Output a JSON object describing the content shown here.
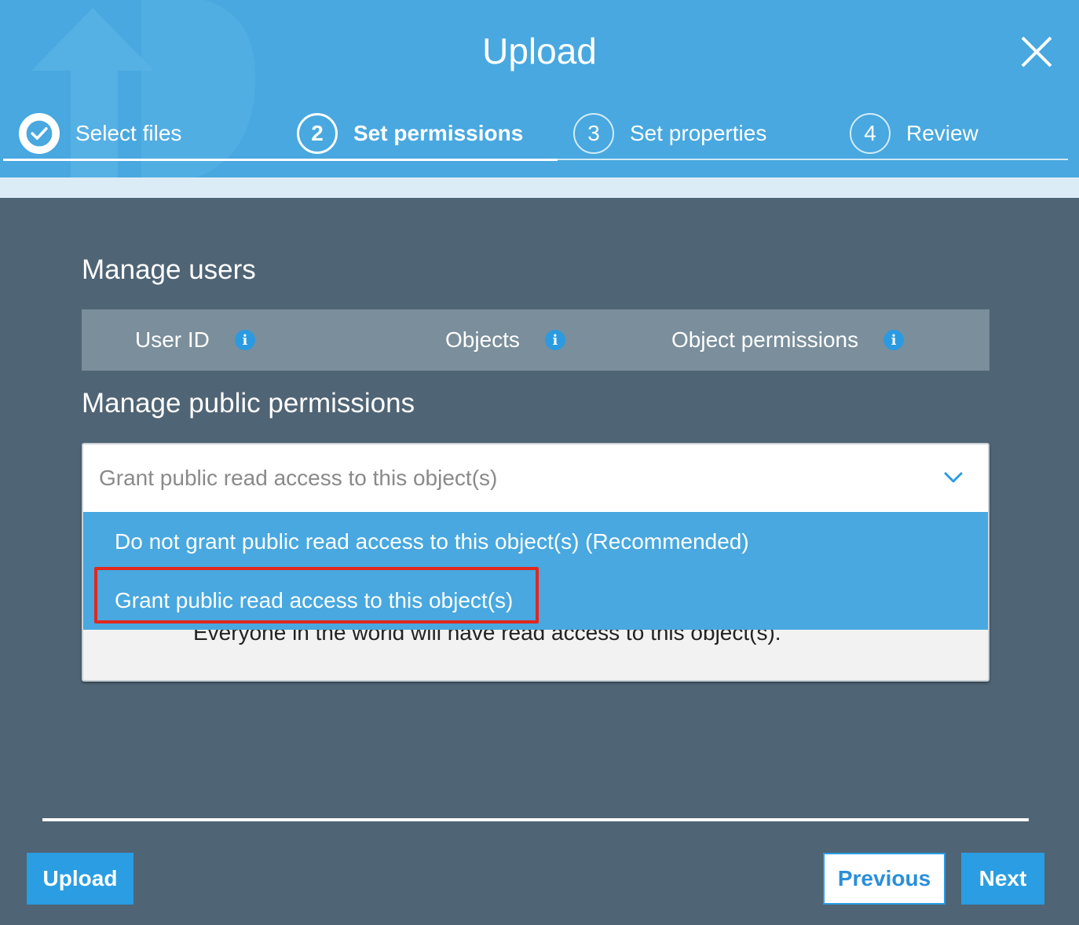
{
  "modal": {
    "title": "Upload",
    "close_label": "Close"
  },
  "steps": [
    {
      "number": "1",
      "label": "Select files",
      "state": "completed"
    },
    {
      "number": "2",
      "label": "Set permissions",
      "state": "active"
    },
    {
      "number": "3",
      "label": "Set properties",
      "state": "upcoming"
    },
    {
      "number": "4",
      "label": "Review",
      "state": "upcoming"
    }
  ],
  "manage_users": {
    "title": "Manage users",
    "columns": [
      "User ID",
      "Objects",
      "Object permissions"
    ]
  },
  "public_permissions": {
    "title": "Manage public permissions",
    "selected_value": "Grant public read access to this object(s)",
    "options": [
      "Do not grant public read access to this object(s) (Recommended)",
      "Grant public read access to this object(s)"
    ],
    "highlighted_option_index": 1,
    "description": "Everyone in the world will have read access to this object(s)."
  },
  "footer": {
    "upload_label": "Upload",
    "previous_label": "Previous",
    "next_label": "Next"
  },
  "colors": {
    "header_blue": "#48a8df",
    "body_slate": "#4f6475",
    "table_header": "#7a8e9b",
    "primary_button": "#2a9de3",
    "highlight_red": "#e0281f"
  }
}
